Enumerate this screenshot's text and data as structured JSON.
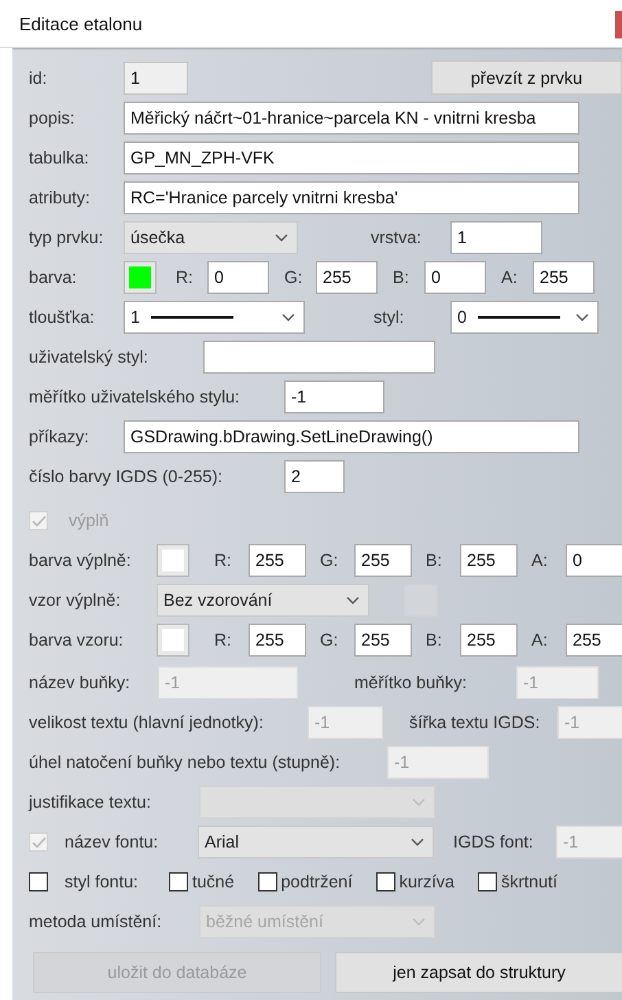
{
  "window": {
    "title": "Editace etalonu"
  },
  "form": {
    "id": {
      "label": "id:",
      "value": "1",
      "readonly": true
    },
    "take_over_button": {
      "label": "převzít z prvku"
    },
    "description": {
      "label": "popis:",
      "value": "Měřický náčrt~01-hranice~parcela KN - vnitrni kresba"
    },
    "table": {
      "label": "tabulka:",
      "value": "GP_MN_ZPH-VFK"
    },
    "attributes": {
      "label": "atributy:",
      "value": "RC='Hranice parcely vnitrni kresba'"
    },
    "element_type": {
      "label": "typ prvku:",
      "value": "úsečka"
    },
    "layer": {
      "label": "vrstva:",
      "value": "1"
    },
    "color": {
      "label": "barva:",
      "color": "#00ff00",
      "channels": [
        {
          "label": "R:",
          "value": "0"
        },
        {
          "label": "G:",
          "value": "255"
        },
        {
          "label": "B:",
          "value": "0"
        },
        {
          "label": "A:",
          "value": "255"
        }
      ]
    },
    "thickness": {
      "label": "tloušťka:",
      "value": "1"
    },
    "style": {
      "label": "styl:",
      "value": "0"
    },
    "user_style": {
      "label": "uživatelský styl:"
    },
    "user_style_scale": {
      "label": "měřítko uživatelského stylu:",
      "value": "-1"
    },
    "commands": {
      "label": "příkazy:",
      "value": "GSDrawing.bDrawing.SetLineDrawing()"
    },
    "igds_color": {
      "label": "číslo barvy IGDS (0-255):",
      "value": "2"
    },
    "fill": {
      "label": "výplň",
      "checked": true,
      "disabled": true
    },
    "fill_color": {
      "label": "barva výplně:",
      "color": "#ffffff",
      "channels": [
        {
          "label": "R:",
          "value": "255"
        },
        {
          "label": "G:",
          "value": "255"
        },
        {
          "label": "B:",
          "value": "255"
        },
        {
          "label": "A:",
          "value": "0"
        }
      ]
    },
    "fill_pattern": {
      "label": "vzor výplně:",
      "value": "Bez vzorování"
    },
    "pattern_color": {
      "label": "barva vzoru:",
      "color": "#ffffff",
      "channels": [
        {
          "label": "R:",
          "value": "255"
        },
        {
          "label": "G:",
          "value": "255"
        },
        {
          "label": "B:",
          "value": "255"
        },
        {
          "label": "A:",
          "value": "255"
        }
      ]
    },
    "cell_name": {
      "label": "název buňky:",
      "value": "-1",
      "disabled": true
    },
    "cell_scale": {
      "label": "měřítko buňky:",
      "value": "-1",
      "disabled": true
    },
    "text_size": {
      "label": "velikost textu (hlavní jednotky):",
      "value": "-1",
      "disabled": true
    },
    "igds_text_width": {
      "label": "šířka textu IGDS:",
      "value": "-1",
      "disabled": true
    },
    "rotation": {
      "label": "úhel natočení buňky nebo textu (stupně):",
      "value": "-1",
      "disabled": true
    },
    "justification": {
      "label": "justifikace textu:",
      "disabled": true
    },
    "font_name": {
      "label": "název fontu:",
      "checked": true,
      "check_disabled": true,
      "value": "Arial"
    },
    "igds_font": {
      "label": "IGDS font:",
      "value": "-1",
      "disabled": true
    },
    "font_style": {
      "label": "styl fontu:",
      "checked": false,
      "options": [
        {
          "label": "tučné",
          "checked": false
        },
        {
          "label": "podtržení",
          "checked": false
        },
        {
          "label": "kurzíva",
          "checked": false
        },
        {
          "label": "škrtnutí",
          "checked": false
        }
      ]
    },
    "placement": {
      "label": "metoda umístění:",
      "value": "běžné umístění",
      "disabled": true
    },
    "buttons": [
      {
        "label": "uložit do databáze",
        "disabled": true
      },
      {
        "label": "jen zapsat do struktury",
        "disabled": false
      }
    ]
  }
}
